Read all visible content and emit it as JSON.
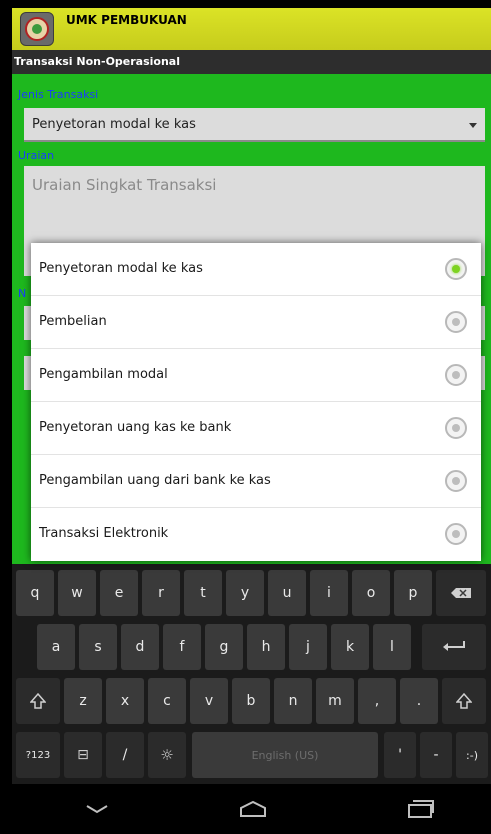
{
  "app": {
    "title": "UMK PEMBUKUAN"
  },
  "subheader": {
    "title": "Transaksi Non-Operasional"
  },
  "form": {
    "jenis_label": "Jenis Transaksi",
    "jenis_value": "Penyetoran modal ke kas",
    "uraian_label": "Uraian",
    "uraian_placeholder": "Uraian Singkat Transaksi",
    "partial_label": "N"
  },
  "dialog": {
    "options": [
      {
        "label": "Penyetoran modal ke kas",
        "selected": true
      },
      {
        "label": "Pembelian",
        "selected": false
      },
      {
        "label": "Pengambilan modal",
        "selected": false
      },
      {
        "label": "Penyetoran uang kas ke bank",
        "selected": false
      },
      {
        "label": "Pengambilan uang dari bank ke kas",
        "selected": false
      },
      {
        "label": "Transaksi Elektronik",
        "selected": false
      }
    ]
  },
  "keyboard": {
    "row1": [
      "q",
      "w",
      "e",
      "r",
      "t",
      "y",
      "u",
      "i",
      "o",
      "p"
    ],
    "row2": [
      "a",
      "s",
      "d",
      "f",
      "g",
      "h",
      "j",
      "k",
      "l"
    ],
    "row3": [
      "z",
      "x",
      "c",
      "v",
      "b",
      "n",
      "m",
      ",",
      "."
    ],
    "row4": {
      "symbols": "?123",
      "space": "English (US)",
      "apostrophe": "'",
      "dash": "-",
      "smiley": ":-)",
      "slash": "/"
    }
  },
  "colors": {
    "accent": "#1eb81e",
    "actionbar": "#d2d822",
    "selected_radio": "#7ed321"
  }
}
